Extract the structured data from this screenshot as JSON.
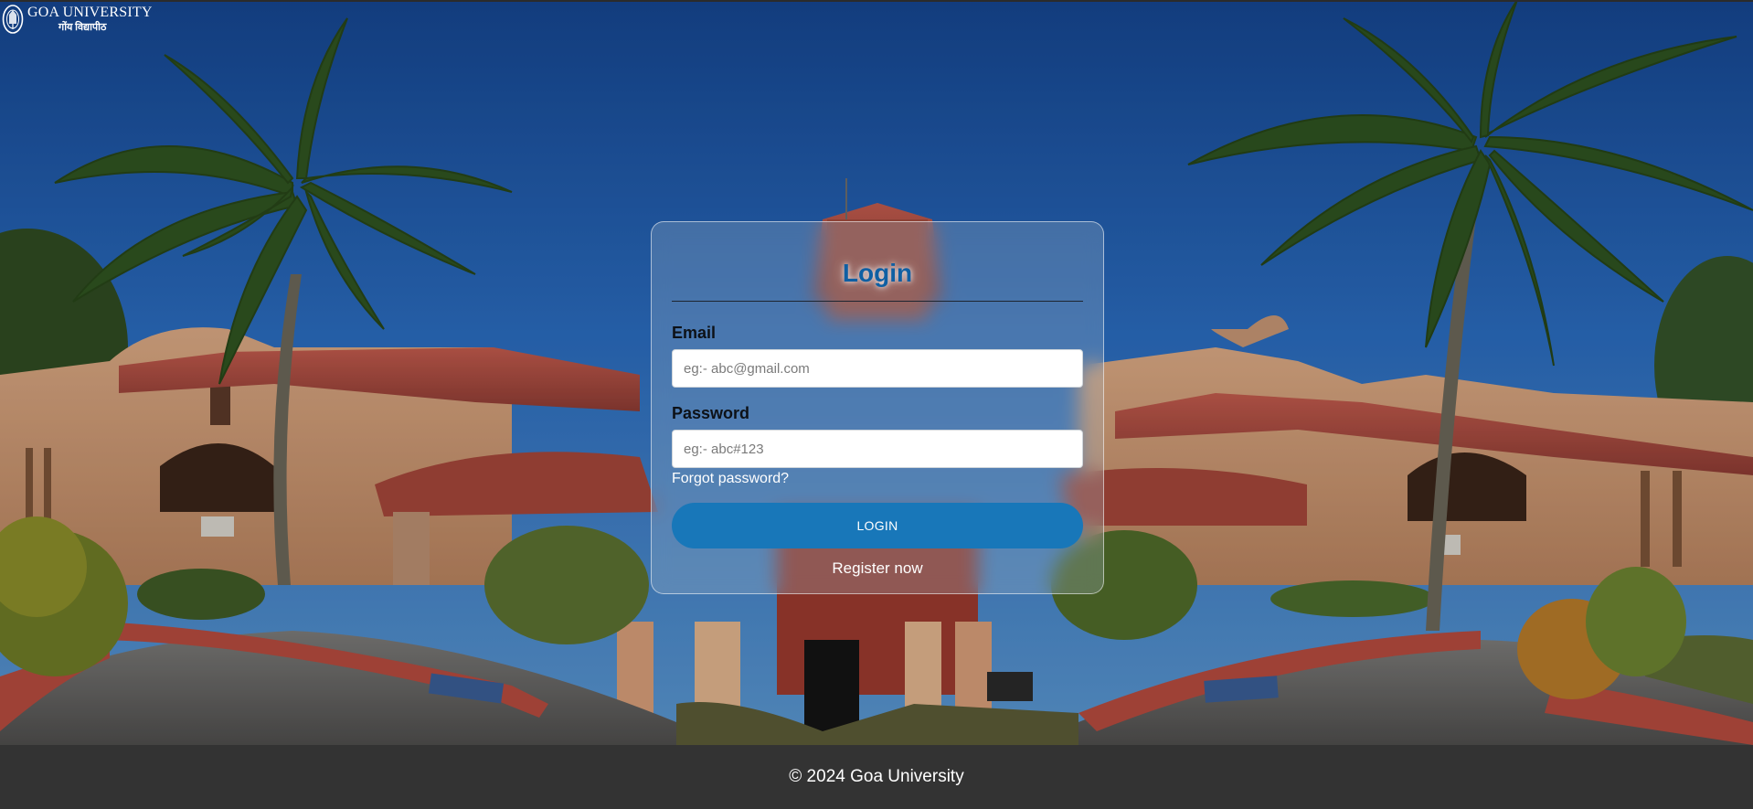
{
  "brand": {
    "name": "GOA UNIVERSITY",
    "name_devanagari": "गोंय विद्यापीठ"
  },
  "login": {
    "title": "Login",
    "email_label": "Email",
    "email_placeholder": "eg:- abc@gmail.com",
    "email_value": "",
    "password_label": "Password",
    "password_placeholder": "eg:- abc#123",
    "password_value": "",
    "forgot_label": "Forgot password?",
    "submit_label": "LOGIN",
    "register_label": "Register now"
  },
  "footer": {
    "copyright": "© 2024 Goa University"
  },
  "colors": {
    "title": "#0f5fa3",
    "button": "#1877b9",
    "footer_bg": "#333333"
  },
  "icons": {
    "logo": "university-emblem-icon"
  }
}
